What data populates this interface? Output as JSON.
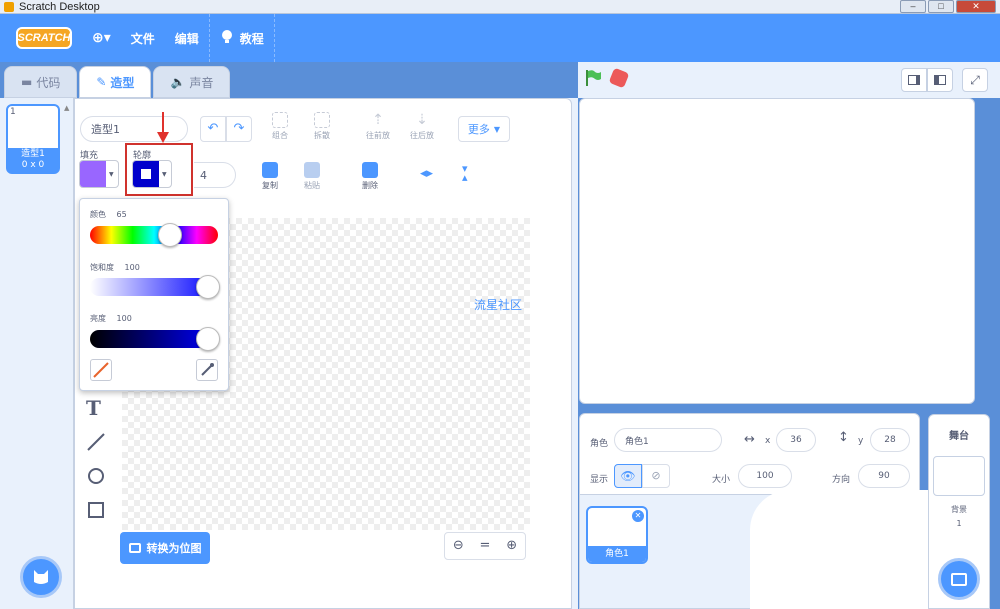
{
  "window": {
    "title": "Scratch Desktop"
  },
  "menubar": {
    "logo": "SCRATCH",
    "globe": "⊕▾",
    "file": "文件",
    "edit": "编辑",
    "tutorials": "教程"
  },
  "tabs": [
    {
      "label": "代码"
    },
    {
      "label": "造型"
    },
    {
      "label": "声音"
    }
  ],
  "costume_list": {
    "items": [
      {
        "number": "1",
        "name": "造型1",
        "size": "0 x 0"
      }
    ]
  },
  "editor": {
    "costume_name": "造型1",
    "group": "组合",
    "ungroup": "拆散",
    "forward": "往前放",
    "backward": "往后放",
    "more": "更多",
    "fill_label": "填充",
    "outline_label": "轮廓",
    "outline_width": "4",
    "copy": "复制",
    "paste": "粘贴",
    "delete": "删除",
    "convert_button": "转换为位图",
    "watermark": "流星社区"
  },
  "color_popup": {
    "hue_label": "颜色",
    "hue_value": "65",
    "saturation_label": "饱和度",
    "saturation_value": "100",
    "brightness_label": "亮度",
    "brightness_value": "100"
  },
  "sprite_info": {
    "sprite_label": "角色",
    "sprite_name": "角色1",
    "x_label": "x",
    "x_value": "36",
    "y_label": "y",
    "y_value": "28",
    "show_label": "显示",
    "size_label": "大小",
    "size_value": "100",
    "direction_label": "方向",
    "direction_value": "90"
  },
  "sprite_list": {
    "items": [
      {
        "name": "角色1"
      }
    ]
  },
  "stage_panel": {
    "title": "舞台",
    "backdrops_label": "背景",
    "backdrops_count": "1"
  },
  "colors": {
    "accent": "#4c97ff",
    "fill_swatch": "#9966ff",
    "outline_swatch": "#0000cc",
    "arrow": "#e0322d"
  }
}
